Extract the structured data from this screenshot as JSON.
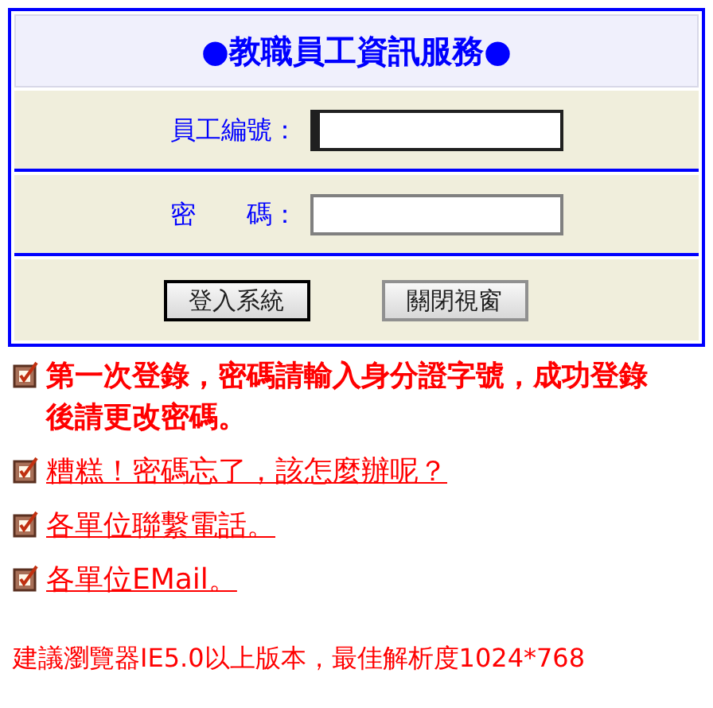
{
  "login": {
    "title": "●教職員工資訊服務●",
    "fields": [
      {
        "label": "員工編號：",
        "focused": true
      },
      {
        "label": "密　　碼：",
        "focused": false
      }
    ],
    "buttons": [
      {
        "label": "登入系統",
        "selected": true
      },
      {
        "label": "關閉視窗",
        "selected": false
      }
    ]
  },
  "notes": [
    {
      "kind": "note",
      "text": "第一次登錄，密碼請輸入身分證字號，成功登錄後請更改密碼。"
    },
    {
      "kind": "link",
      "text": "糟糕！密碼忘了，該怎麼辦呢？"
    },
    {
      "kind": "link",
      "text": "各單位聯繫電話。"
    },
    {
      "kind": "link",
      "text": "各單位EMail。"
    }
  ],
  "footer": "建議瀏覽器IE5.0以上版本，最佳解析度1024*768"
}
